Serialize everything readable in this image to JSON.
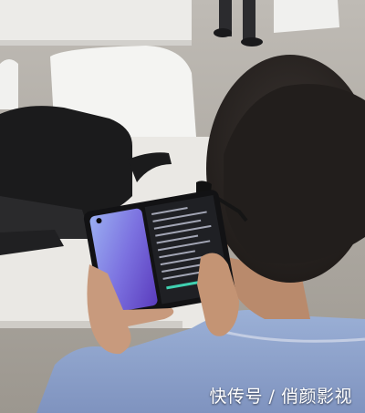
{
  "photo": {
    "subject": "person-holding-foldable-tablet",
    "colors": {
      "background": "#d7d5d1",
      "table": "#e9e7e3",
      "shirt": "#8fa3c9",
      "hair": "#2a2522",
      "skin": "#c89a7d",
      "screen_gradient_top": "#8a9fe8",
      "screen_gradient_bottom": "#6a4cc8",
      "backpack": "#1b1b1c"
    }
  },
  "watermark": {
    "text": "快传号 / 俏颜影视"
  }
}
